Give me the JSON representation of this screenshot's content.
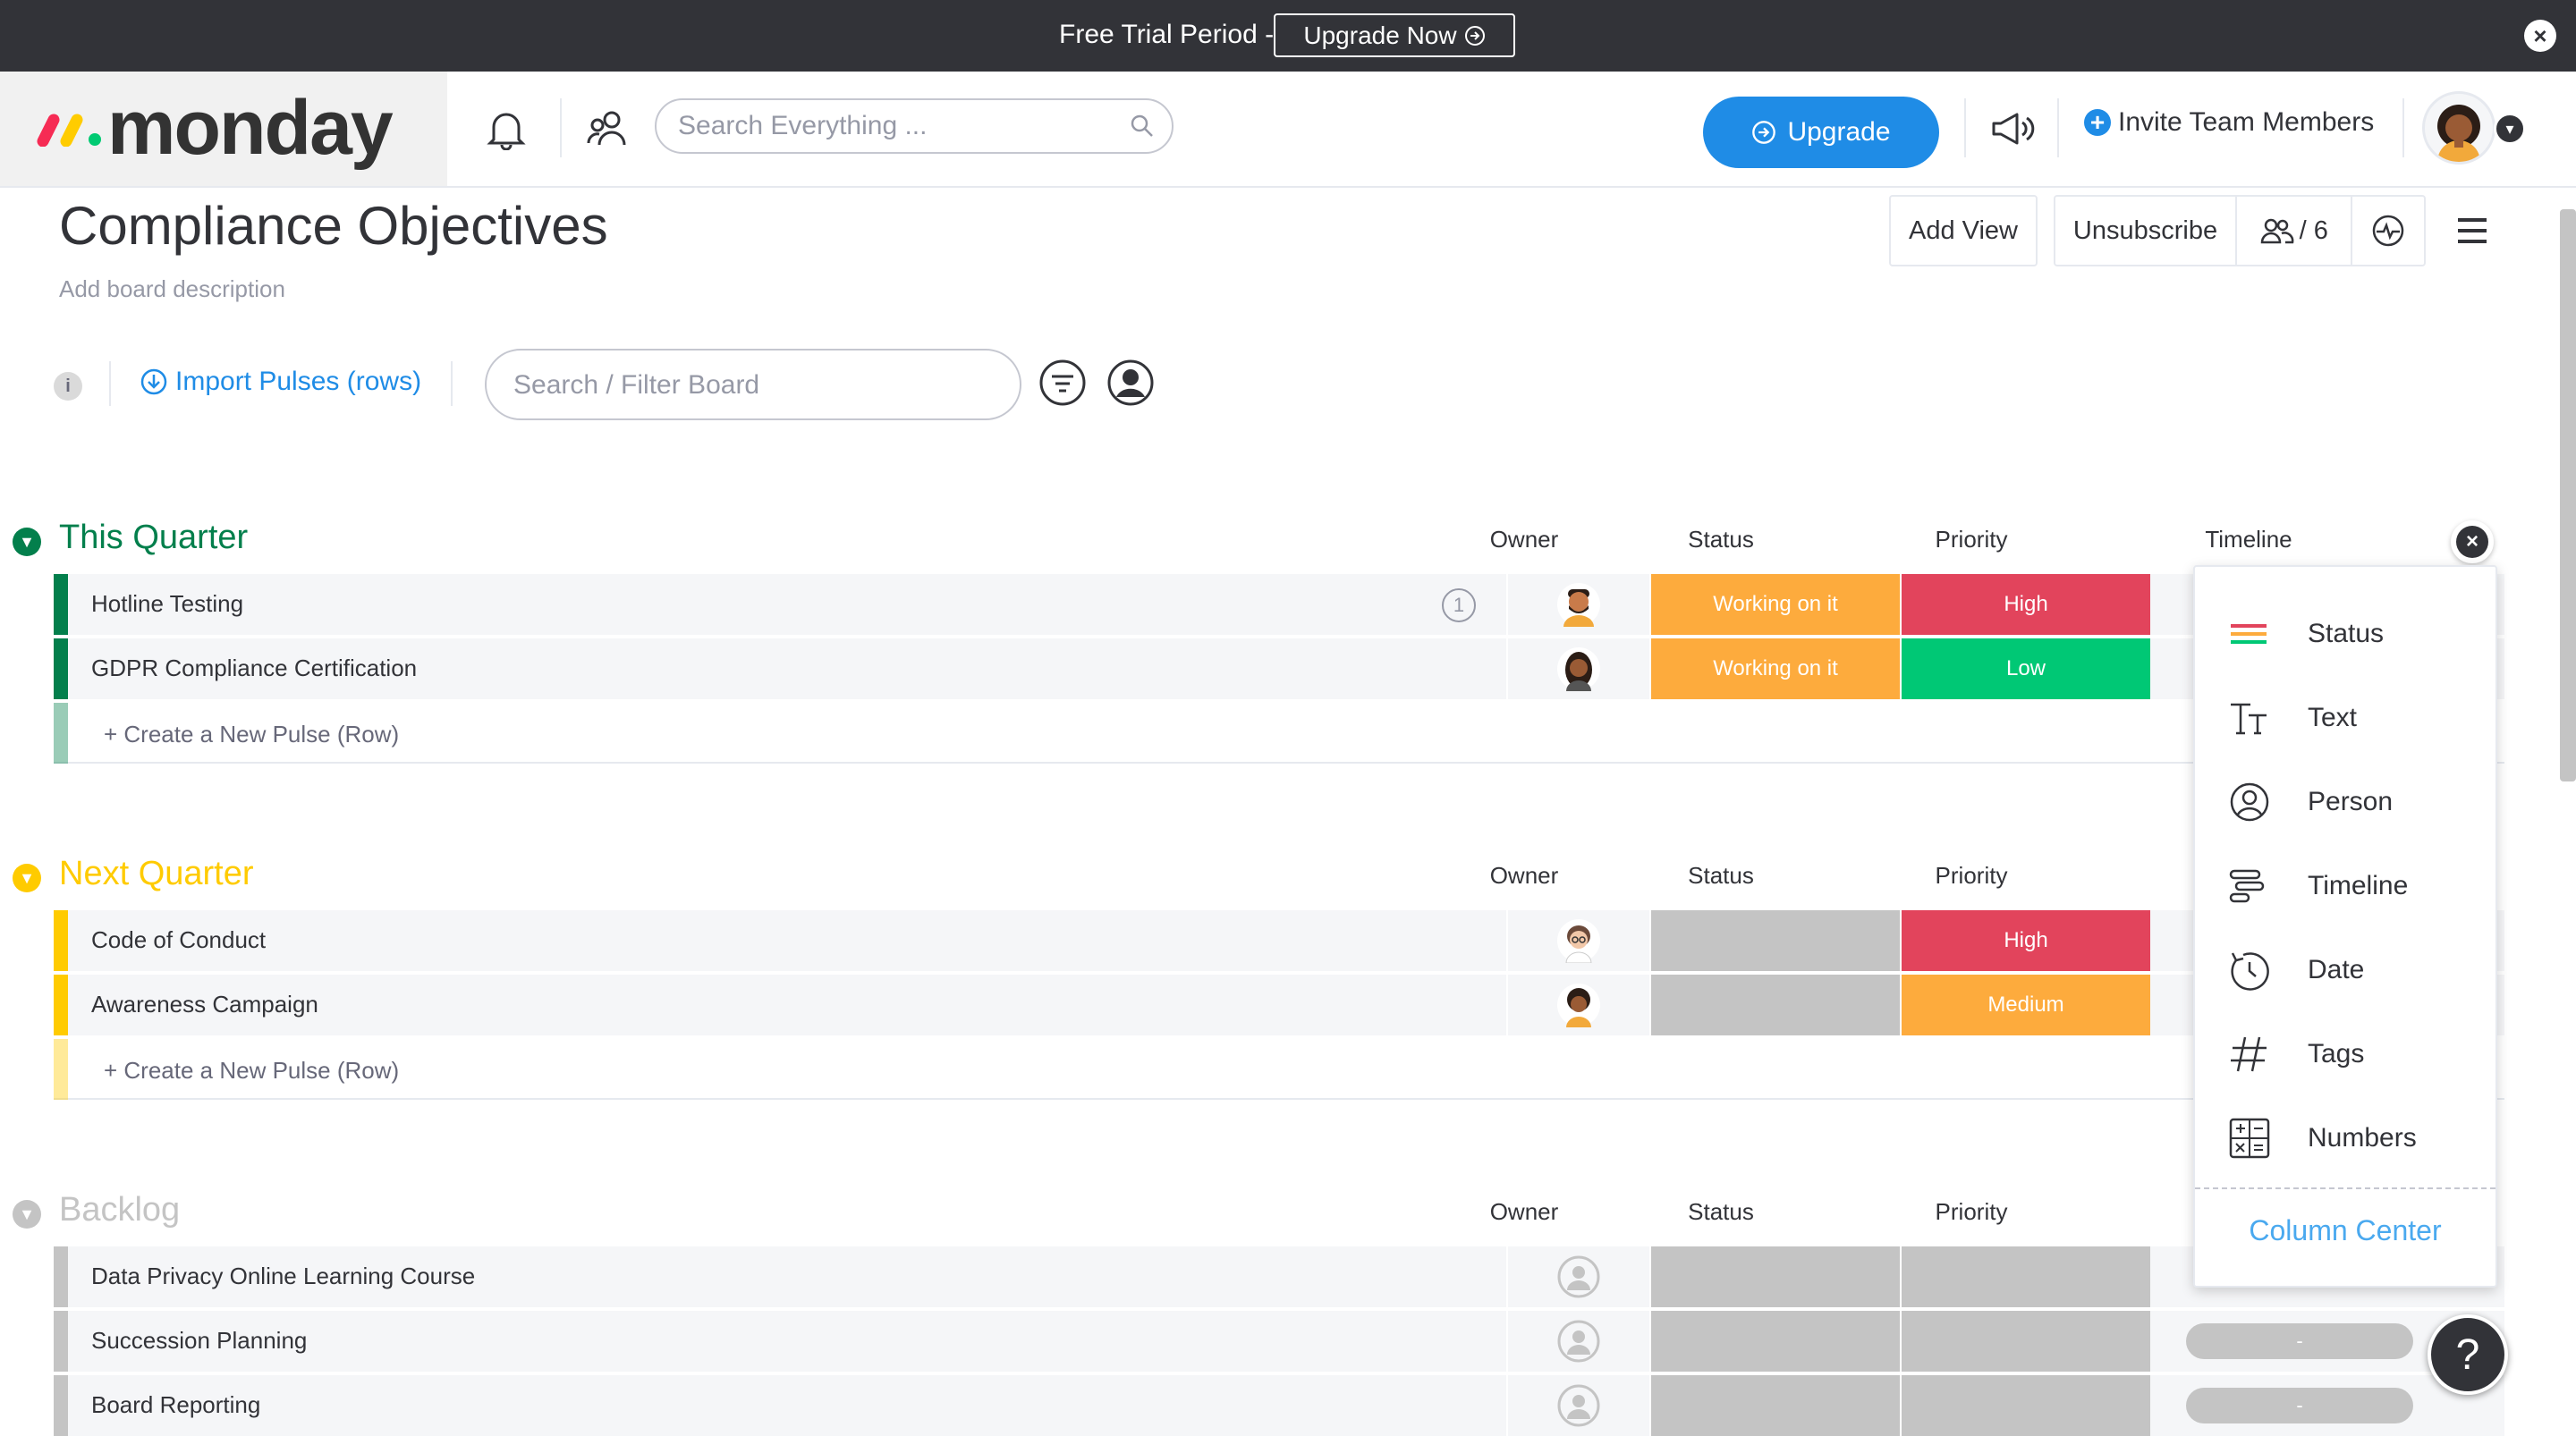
{
  "trial_banner": {
    "text": "Free Trial Period -",
    "button": "Upgrade Now"
  },
  "header": {
    "logo": "monday",
    "search_placeholder": "Search Everything ...",
    "upgrade_label": "Upgrade",
    "invite_label": "Invite Team Members"
  },
  "board": {
    "title": "Compliance Objectives",
    "description": "Add board description",
    "add_view": "Add View",
    "unsubscribe": "Unsubscribe",
    "members": "/ 6"
  },
  "toolbar": {
    "info": "i",
    "import_label": "Import Pulses (rows)",
    "filter_placeholder": "Search / Filter Board"
  },
  "columns": {
    "owner": "Owner",
    "status": "Status",
    "priority": "Priority",
    "timeline": "Timeline"
  },
  "create_row_label": "+ Create a New Pulse (Row)",
  "colors": {
    "this_quarter": "#037f4c",
    "next_quarter": "#ffcb00",
    "backlog": "#c4c4c4",
    "working_on_it": "#fdab3d",
    "high": "#e2445c",
    "low": "#00c875",
    "medium": "#fdab3d",
    "empty": "#c4c4c4"
  },
  "groups": [
    {
      "title": "This Quarter",
      "rows": [
        {
          "name": "Hotline Testing",
          "updates": "1",
          "owner": "man-avatar",
          "status": "Working on it",
          "priority": "High"
        },
        {
          "name": "GDPR Compliance Certification",
          "owner": "woman-avatar",
          "status": "Working on it",
          "priority": "Low"
        }
      ]
    },
    {
      "title": "Next Quarter",
      "rows": [
        {
          "name": "Code of Conduct",
          "owner": "woman-glasses-avatar",
          "status": "",
          "priority": "High"
        },
        {
          "name": "Awareness Campaign",
          "owner": "woman-avatar",
          "status": "",
          "priority": "Medium"
        }
      ]
    },
    {
      "title": "Backlog",
      "rows": [
        {
          "name": "Data Privacy Online Learning Course",
          "owner": "empty-person",
          "status": "",
          "priority": "",
          "timeline": ""
        },
        {
          "name": "Succession Planning",
          "owner": "empty-person",
          "status": "",
          "priority": "",
          "timeline": "-"
        },
        {
          "name": "Board Reporting",
          "owner": "empty-person",
          "status": "",
          "priority": "",
          "timeline": "-"
        }
      ]
    }
  ],
  "column_menu": {
    "items": [
      {
        "label": "Status",
        "icon": "status-icon"
      },
      {
        "label": "Text",
        "icon": "text-icon"
      },
      {
        "label": "Person",
        "icon": "person-icon"
      },
      {
        "label": "Timeline",
        "icon": "timeline-icon"
      },
      {
        "label": "Date",
        "icon": "date-icon"
      },
      {
        "label": "Tags",
        "icon": "tags-icon"
      },
      {
        "label": "Numbers",
        "icon": "numbers-icon"
      }
    ],
    "footer": "Column Center"
  },
  "help": "?"
}
